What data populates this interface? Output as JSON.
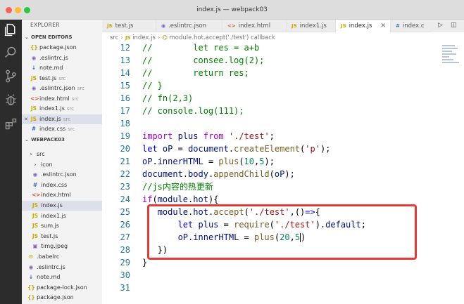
{
  "window": {
    "title": "index.js — webpack03"
  },
  "sidebar": {
    "title": "EXPLORER",
    "open_editors_label": "OPEN EDITORS",
    "open_editors": [
      {
        "icon": "{}",
        "icon_color": "#c9a800",
        "name": "package.json",
        "hint": ""
      },
      {
        "icon": "◉",
        "icon_color": "#7b5fc7",
        "name": ".eslintrc.js",
        "hint": ""
      },
      {
        "icon": "↓",
        "icon_color": "#3a6bc4",
        "name": "note.md",
        "hint": ""
      },
      {
        "icon": "JS",
        "icon_color": "#c9a800",
        "name": "test.js",
        "hint": "src"
      },
      {
        "icon": "◉",
        "icon_color": "#7b5fc7",
        "name": ".eslintrc.json",
        "hint": "src"
      },
      {
        "icon": "<>",
        "icon_color": "#e4572e",
        "name": "index.html",
        "hint": "src"
      },
      {
        "icon": "JS",
        "icon_color": "#c9a800",
        "name": "index1.js",
        "hint": "src"
      },
      {
        "icon": "JS",
        "icon_color": "#c9a800",
        "name": "index.js",
        "hint": "src"
      },
      {
        "icon": "#",
        "icon_color": "#3a6bc4",
        "name": "index.css",
        "hint": "src"
      }
    ],
    "project_label": "WEBPACK03",
    "tree": [
      {
        "icon": "›",
        "icon_color": "#666",
        "name": "src",
        "indent": 1
      },
      {
        "icon": "›",
        "icon_color": "#666",
        "name": "icon",
        "indent": 2
      },
      {
        "icon": "◉",
        "icon_color": "#7b5fc7",
        "name": ".eslintrc.json",
        "indent": 2
      },
      {
        "icon": "#",
        "icon_color": "#3a6bc4",
        "name": "index.css",
        "indent": 2
      },
      {
        "icon": "<>",
        "icon_color": "#e4572e",
        "name": "index.html",
        "indent": 2
      },
      {
        "icon": "JS",
        "icon_color": "#c9a800",
        "name": "index.js",
        "indent": 2
      },
      {
        "icon": "JS",
        "icon_color": "#c9a800",
        "name": "index1.js",
        "indent": 2
      },
      {
        "icon": "JS",
        "icon_color": "#c9a800",
        "name": "sum.js",
        "indent": 2
      },
      {
        "icon": "JS",
        "icon_color": "#c9a800",
        "name": "test.js",
        "indent": 2
      },
      {
        "icon": "▣",
        "icon_color": "#8a63b8",
        "name": "timg.jpeg",
        "indent": 2
      },
      {
        "icon": "⚙",
        "icon_color": "#c9a800",
        "name": ".babelrc",
        "indent": 1
      },
      {
        "icon": "◉",
        "icon_color": "#7b5fc7",
        "name": ".eslintrc.js",
        "indent": 1
      },
      {
        "icon": "↓",
        "icon_color": "#3a6bc4",
        "name": "note.md",
        "indent": 1
      },
      {
        "icon": "{}",
        "icon_color": "#c9a800",
        "name": "package-lock.json",
        "indent": 1
      },
      {
        "icon": "{}",
        "icon_color": "#c9a800",
        "name": "package.json",
        "indent": 1
      }
    ]
  },
  "tabs": [
    {
      "icon": "JS",
      "icon_color": "#c9a800",
      "label": "test.js",
      "active": false
    },
    {
      "icon": "◉",
      "icon_color": "#7b5fc7",
      "label": ".eslintrc.json",
      "active": false
    },
    {
      "icon": "<>",
      "icon_color": "#e4572e",
      "label": "index.html",
      "active": false
    },
    {
      "icon": "JS",
      "icon_color": "#c9a800",
      "label": "index1.js",
      "active": false
    },
    {
      "icon": "JS",
      "icon_color": "#c9a800",
      "label": "index.js",
      "active": true
    },
    {
      "icon": "#",
      "icon_color": "#3a6bc4",
      "label": "index.c",
      "active": false
    }
  ],
  "breadcrumb": {
    "parts": [
      "src",
      "index.js",
      "module.hot.accept('./test') callback"
    ],
    "file_icon": "JS"
  },
  "editor": {
    "lines": [
      {
        "n": "12",
        "tokens": [
          [
            "c-cm",
            "//        let res = a+b"
          ]
        ]
      },
      {
        "n": "13",
        "tokens": [
          [
            "c-cm",
            "//        consee.log(2);"
          ]
        ]
      },
      {
        "n": "14",
        "tokens": [
          [
            "c-cm",
            "//        return res;"
          ]
        ]
      },
      {
        "n": "15",
        "tokens": [
          [
            "c-cm",
            "// }"
          ]
        ]
      },
      {
        "n": "16",
        "tokens": [
          [
            "c-cm",
            "// fn(2,3)"
          ]
        ]
      },
      {
        "n": "17",
        "tokens": [
          [
            "c-cm",
            "// console.log(111);"
          ]
        ]
      },
      {
        "n": "18",
        "tokens": []
      },
      {
        "n": "19",
        "tokens": [
          [
            "c-kw2",
            "import"
          ],
          [
            "c-plain",
            " "
          ],
          [
            "c-var",
            "plus"
          ],
          [
            "c-plain",
            " "
          ],
          [
            "c-kw2",
            "from"
          ],
          [
            "c-plain",
            " "
          ],
          [
            "c-str",
            "'./test'"
          ],
          [
            "c-plain",
            ";"
          ]
        ]
      },
      {
        "n": "20",
        "tokens": [
          [
            "c-kw",
            "let"
          ],
          [
            "c-plain",
            " "
          ],
          [
            "c-var",
            "oP"
          ],
          [
            "c-plain",
            " = "
          ],
          [
            "c-var",
            "document"
          ],
          [
            "c-plain",
            "."
          ],
          [
            "c-fn",
            "createElement"
          ],
          [
            "c-plain",
            "("
          ],
          [
            "c-str",
            "'p'"
          ],
          [
            "c-plain",
            ");"
          ]
        ]
      },
      {
        "n": "21",
        "tokens": [
          [
            "c-var",
            "oP"
          ],
          [
            "c-plain",
            "."
          ],
          [
            "c-var",
            "innerHTML"
          ],
          [
            "c-plain",
            " = "
          ],
          [
            "c-fn",
            "plus"
          ],
          [
            "c-plain",
            "("
          ],
          [
            "c-num",
            "10"
          ],
          [
            "c-plain",
            ","
          ],
          [
            "c-num",
            "5"
          ],
          [
            "c-plain",
            ");"
          ]
        ]
      },
      {
        "n": "22",
        "tokens": [
          [
            "c-var",
            "document"
          ],
          [
            "c-plain",
            "."
          ],
          [
            "c-var",
            "body"
          ],
          [
            "c-plain",
            "."
          ],
          [
            "c-fn",
            "appendChild"
          ],
          [
            "c-plain",
            "("
          ],
          [
            "c-var",
            "oP"
          ],
          [
            "c-plain",
            ");"
          ]
        ]
      },
      {
        "n": "23",
        "tokens": [
          [
            "c-cm",
            "//js内容的热更新"
          ]
        ]
      },
      {
        "n": "24",
        "tokens": [
          [
            "c-kw2",
            "if"
          ],
          [
            "c-plain",
            "("
          ],
          [
            "c-var",
            "module"
          ],
          [
            "c-plain",
            "."
          ],
          [
            "c-var",
            "hot"
          ],
          [
            "c-plain",
            "){"
          ]
        ]
      },
      {
        "n": "25",
        "tokens": [
          [
            "c-plain",
            "   "
          ],
          [
            "c-var",
            "module"
          ],
          [
            "c-plain",
            "."
          ],
          [
            "c-var",
            "hot"
          ],
          [
            "c-plain",
            "."
          ],
          [
            "c-fn",
            "accept"
          ],
          [
            "c-plain",
            "("
          ],
          [
            "c-str",
            "'./test'"
          ],
          [
            "c-plain",
            ",()"
          ],
          [
            "c-kw",
            "=>"
          ],
          [
            "c-plain",
            "{"
          ]
        ]
      },
      {
        "n": "26",
        "tokens": [
          [
            "c-plain",
            "       "
          ],
          [
            "c-kw",
            "let"
          ],
          [
            "c-plain",
            " "
          ],
          [
            "c-var",
            "plus"
          ],
          [
            "c-plain",
            " = "
          ],
          [
            "c-fn",
            "require"
          ],
          [
            "c-plain",
            "("
          ],
          [
            "c-str",
            "'./test'"
          ],
          [
            "c-plain",
            ")."
          ],
          [
            "c-var",
            "default"
          ],
          [
            "c-plain",
            ";"
          ]
        ]
      },
      {
        "n": "27",
        "tokens": [
          [
            "c-plain",
            "       "
          ],
          [
            "c-var",
            "oP"
          ],
          [
            "c-plain",
            "."
          ],
          [
            "c-var",
            "innerHTML"
          ],
          [
            "c-plain",
            " = "
          ],
          [
            "c-fn",
            "plus"
          ],
          [
            "c-plain",
            "("
          ],
          [
            "c-num",
            "20"
          ],
          [
            "c-plain",
            ","
          ],
          [
            "c-num",
            "5"
          ],
          [
            "cursor",
            ""
          ],
          [
            "c-plain",
            ")"
          ]
        ]
      },
      {
        "n": "28",
        "tokens": [
          [
            "c-plain",
            "   })"
          ]
        ]
      },
      {
        "n": "29",
        "tokens": [
          [
            "c-plain",
            "}"
          ]
        ]
      },
      {
        "n": "30",
        "tokens": []
      },
      {
        "n": "31",
        "tokens": []
      }
    ]
  },
  "colors": {
    "activity_bar": "#2c2c2c",
    "sidebar_bg": "#f3f3f3",
    "highlight_border": "#e53935",
    "line_number": "#237893"
  }
}
